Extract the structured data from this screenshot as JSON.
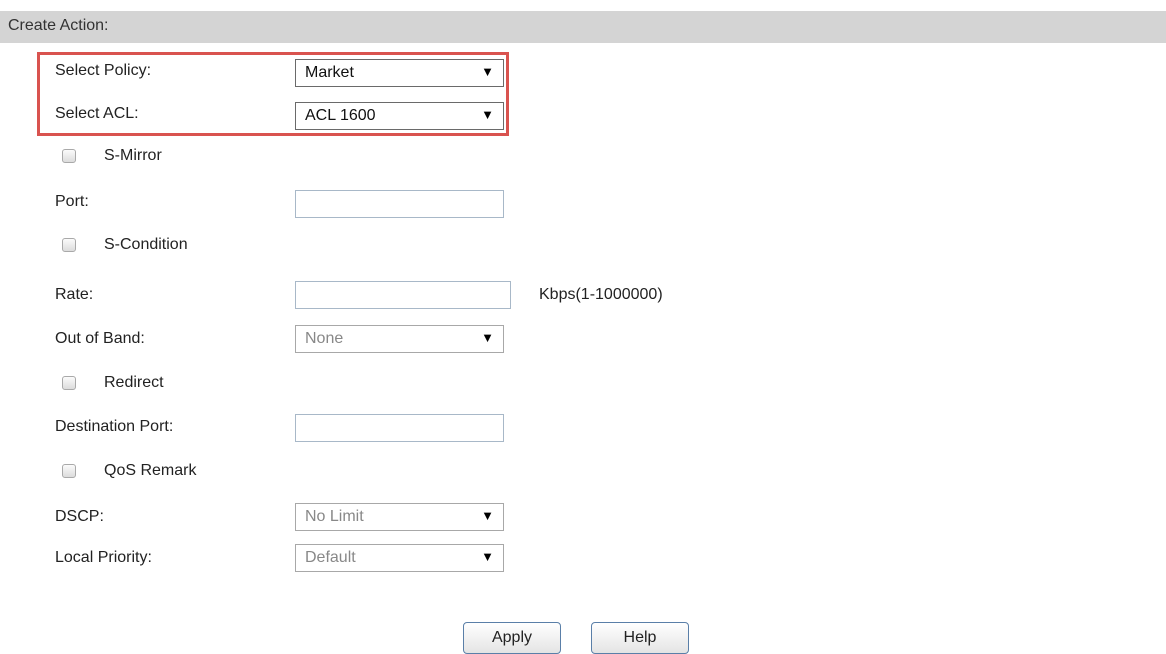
{
  "header": {
    "title": "Create Action:"
  },
  "form": {
    "select_policy": {
      "label": "Select Policy:",
      "value": "Market"
    },
    "select_acl": {
      "label": "Select ACL:",
      "value": "ACL 1600"
    },
    "s_mirror": {
      "label": "S-Mirror",
      "checked": false
    },
    "port": {
      "label": "Port:",
      "value": ""
    },
    "s_condition": {
      "label": "S-Condition",
      "checked": false
    },
    "rate": {
      "label": "Rate:",
      "value": "",
      "unit": "Kbps(1-1000000)"
    },
    "out_of_band": {
      "label": "Out of Band:",
      "value": "None"
    },
    "redirect": {
      "label": "Redirect",
      "checked": false
    },
    "destination_port": {
      "label": "Destination Port:",
      "value": ""
    },
    "qos_remark": {
      "label": "QoS Remark",
      "checked": false
    },
    "dscp": {
      "label": "DSCP:",
      "value": "No Limit"
    },
    "local_priority": {
      "label": "Local Priority:",
      "value": "Default"
    }
  },
  "buttons": {
    "apply": "Apply",
    "help": "Help"
  },
  "icons": {
    "dropdown_arrow": "▼"
  },
  "colors": {
    "highlight_border": "#d9534f",
    "header_bg": "#d4d4d4"
  }
}
